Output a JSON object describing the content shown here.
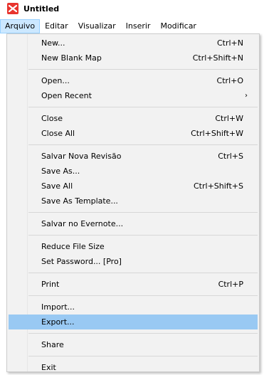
{
  "window": {
    "title": "Untitled",
    "icon": "xmind-logo-icon",
    "icon_color": "#e8342e"
  },
  "menubar": {
    "items": [
      "Arquivo",
      "Editar",
      "Visualizar",
      "Inserir",
      "Modificar"
    ],
    "active_index": 0
  },
  "menu": {
    "highlight_color": "#99c9f3",
    "groups": [
      [
        {
          "label": "New...",
          "shortcut": "Ctrl+N"
        },
        {
          "label": "New Blank Map",
          "shortcut": "Ctrl+Shift+N"
        }
      ],
      [
        {
          "label": "Open...",
          "shortcut": "Ctrl+O"
        },
        {
          "label": "Open Recent",
          "shortcut": "",
          "submenu": true,
          "arrow": "›"
        }
      ],
      [
        {
          "label": "Close",
          "shortcut": "Ctrl+W"
        },
        {
          "label": "Close All",
          "shortcut": "Ctrl+Shift+W"
        }
      ],
      [
        {
          "label": "Salvar Nova Revisão",
          "shortcut": "Ctrl+S"
        },
        {
          "label": "Save As...",
          "shortcut": ""
        },
        {
          "label": "Save All",
          "shortcut": "Ctrl+Shift+S"
        },
        {
          "label": "Save As Template...",
          "shortcut": ""
        }
      ],
      [
        {
          "label": "Salvar no Evernote...",
          "shortcut": ""
        }
      ],
      [
        {
          "label": "Reduce File Size",
          "shortcut": ""
        },
        {
          "label": "Set Password... [Pro]",
          "shortcut": ""
        }
      ],
      [
        {
          "label": "Print",
          "shortcut": "Ctrl+P"
        }
      ],
      [
        {
          "label": "Import...",
          "shortcut": ""
        },
        {
          "label": "Export...",
          "shortcut": "",
          "highlighted": true
        }
      ],
      [
        {
          "label": "Share",
          "shortcut": ""
        }
      ],
      [
        {
          "label": "Exit",
          "shortcut": ""
        }
      ]
    ]
  }
}
